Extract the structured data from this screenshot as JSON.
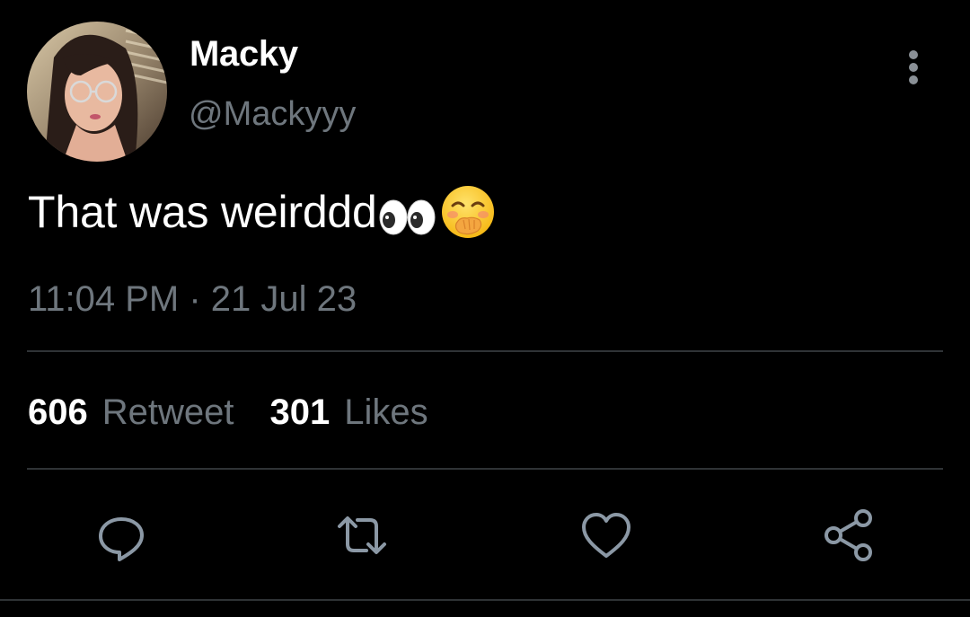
{
  "user": {
    "display_name": "Macky",
    "handle": "@Mackyyy"
  },
  "tweet": {
    "text": "That was weirddd",
    "emojis": [
      "eyes-emoji",
      "face-with-hand-over-mouth-emoji"
    ],
    "timestamp": "11:04 PM · 21 Jul 23"
  },
  "stats": {
    "retweet_count": "606",
    "retweet_label": "Retweet",
    "likes_count": "301",
    "likes_label": "Likes"
  },
  "actions": [
    "reply-icon",
    "retweet-icon",
    "like-icon",
    "share-icon"
  ],
  "colors": {
    "background": "#000000",
    "text_primary": "#ffffff",
    "text_secondary": "#6e767d",
    "divider": "#2f3336",
    "icon": "#8b98a5"
  }
}
